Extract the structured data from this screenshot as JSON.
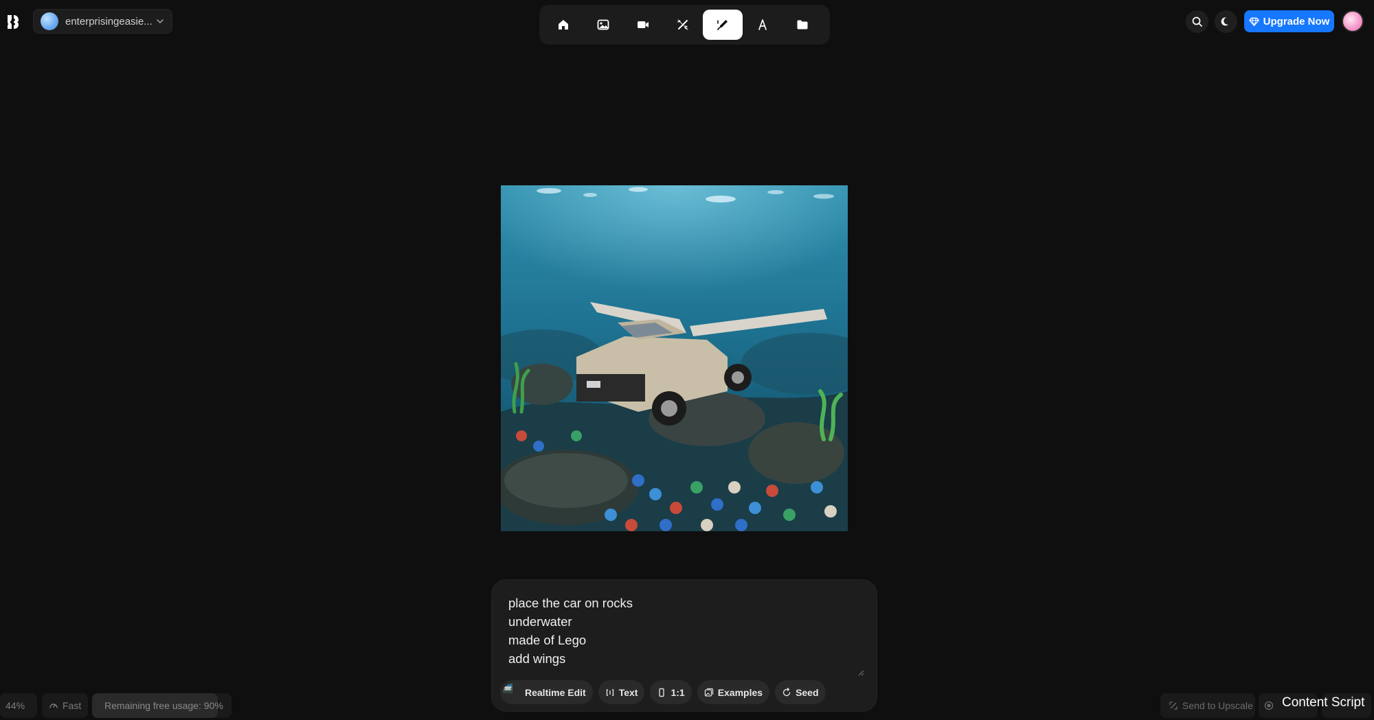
{
  "workspace": {
    "name": "enterprisingeasie..."
  },
  "toolbar": {
    "tools": [
      "home",
      "image",
      "video",
      "enhance",
      "edit",
      "text-style",
      "assets"
    ],
    "active_tool": "edit"
  },
  "header": {
    "upgrade_label": "Upgrade Now"
  },
  "prompt": {
    "text": "place the car on rocks\nunderwater\nmade of Lego\nadd wings"
  },
  "chips": {
    "realtime": "Realtime Edit",
    "text": "Text",
    "ratio": "1:1",
    "examples": "Examples",
    "seed": "Seed"
  },
  "footer": {
    "zoom": "44%",
    "speed": "Fast",
    "usage": "Remaining free usage: 90%",
    "usage_fraction": 0.9,
    "upscale": "Send to Upscale",
    "content_script": "Content Script"
  },
  "colors": {
    "accent": "#1677ff",
    "background": "#0f0f0f",
    "panel": "#1d1d1d"
  }
}
